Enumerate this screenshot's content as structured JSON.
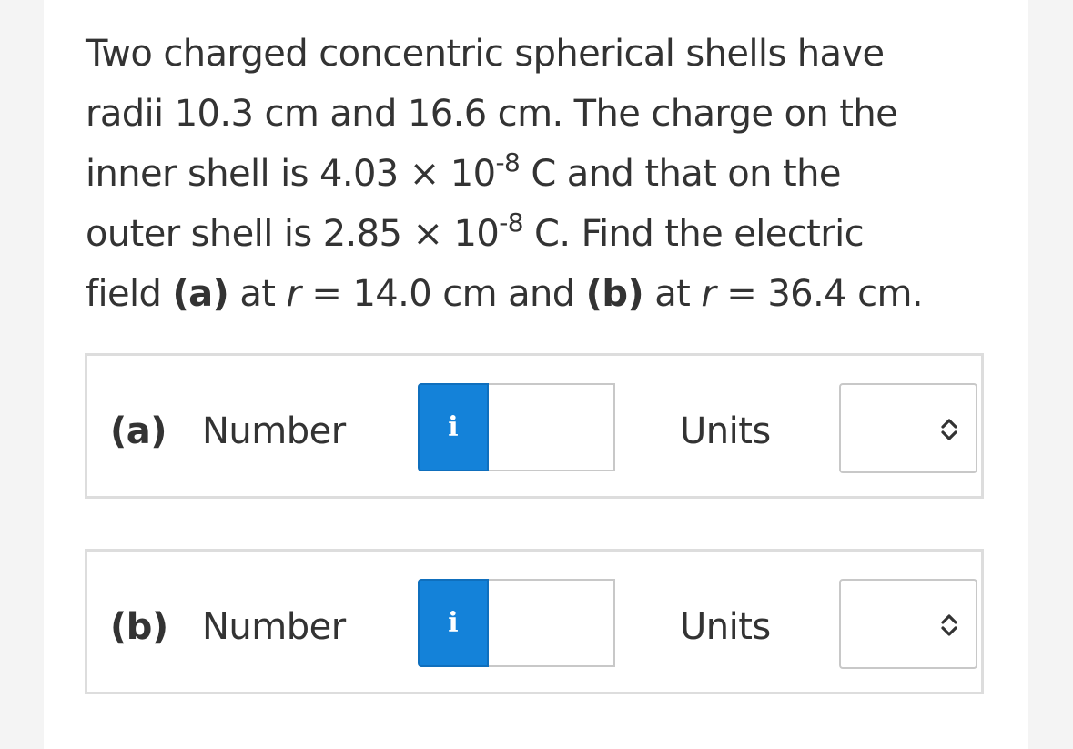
{
  "question": {
    "line1": "Two charged concentric spherical shells have",
    "line2": "radii 10.3 cm and 16.6 cm. The charge on the",
    "line3_pre": "inner shell is 4.03 × 10",
    "line3_exp": "-8",
    "line3_post": " C and that on the",
    "line4_pre": "outer shell is 2.85 × 10",
    "line4_exp": "-8",
    "line4_post": " C. Find the electric",
    "line5_a_pre": "field ",
    "line5_a_label": "(a)",
    "line5_a_mid": " at ",
    "line5_r1": "r",
    "line5_a_val": " = 14.0 cm and ",
    "line5_b_label": "(b)",
    "line5_b_mid": " at ",
    "line5_r2": "r",
    "line5_b_val": " = 36.4 cm."
  },
  "parts": [
    {
      "letter": "(a)",
      "number_label": "Number",
      "info_icon": "i",
      "number_value": "",
      "units_label": "Units",
      "units_value": ""
    },
    {
      "letter": "(b)",
      "number_label": "Number",
      "info_icon": "i",
      "number_value": "",
      "units_label": "Units",
      "units_value": ""
    }
  ],
  "colors": {
    "info_button": "#1482d9",
    "text": "#333333",
    "border": "#dddddd"
  }
}
